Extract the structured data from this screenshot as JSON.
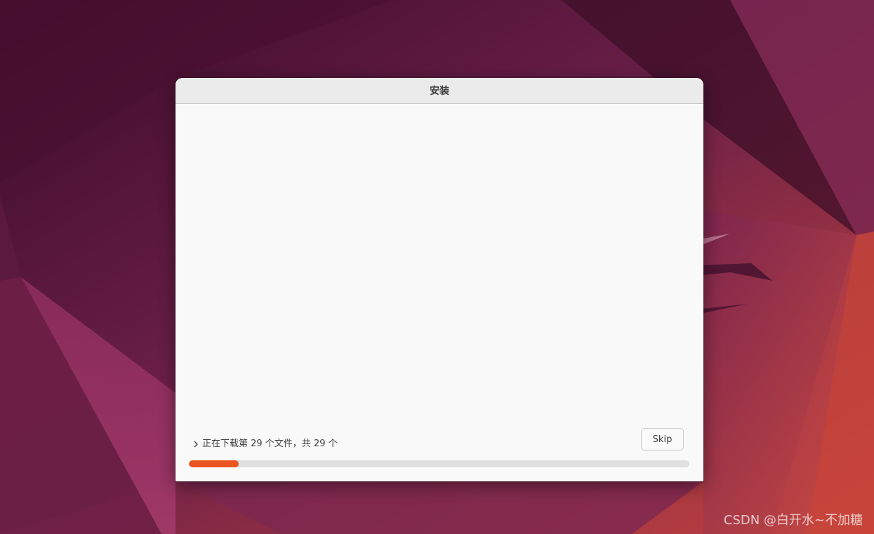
{
  "dialog": {
    "title": "安装",
    "status_text": "正在下载第 29 个文件，共 29 个",
    "skip_label": "Skip",
    "progress": 0.1,
    "expander_icon": "chevron-right-icon",
    "accent_color": "#e95420"
  },
  "watermark": {
    "text": "CSDN @白开水~不加糖"
  }
}
